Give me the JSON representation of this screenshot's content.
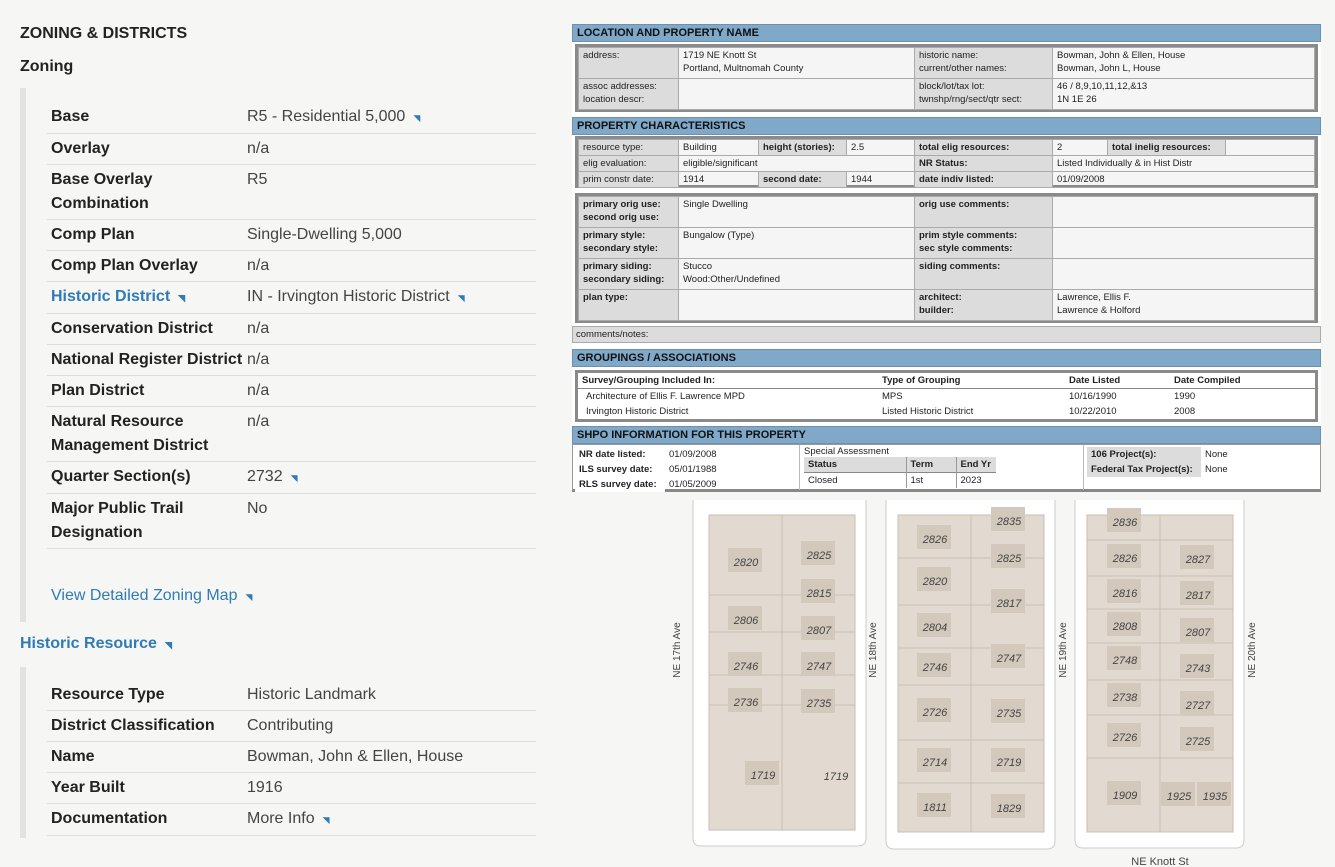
{
  "left": {
    "title": "ZONING & DISTRICTS",
    "subtitle": "Zoning",
    "zoning": [
      {
        "label": "Base",
        "value": "R5 - Residential 5,000",
        "link": true
      },
      {
        "label": "Overlay",
        "value": "n/a"
      },
      {
        "label": "Base Overlay Combination",
        "value": "R5"
      },
      {
        "label": "Comp Plan",
        "value": "Single-Dwelling 5,000"
      },
      {
        "label": "Comp Plan Overlay",
        "value": "n/a"
      },
      {
        "label": "Historic District",
        "value": "IN - Irvington Historic District",
        "link": true
      },
      {
        "label": "Conservation District",
        "value": "n/a"
      },
      {
        "label": "National Register District",
        "value": "n/a"
      },
      {
        "label": "Plan District",
        "value": "n/a"
      },
      {
        "label": "Natural Resource Management District",
        "value": "n/a"
      },
      {
        "label": "Quarter Section(s)",
        "value": "2732",
        "link": true
      },
      {
        "label": "Major Public Trail Designation",
        "value": "No"
      }
    ],
    "view_map_link": "View Detailed Zoning Map",
    "historic_title": "Historic Resource",
    "historic": [
      {
        "label": "Resource Type",
        "value": "Historic Landmark"
      },
      {
        "label": "District Classification",
        "value": "Contributing"
      },
      {
        "label": "Name",
        "value": "Bowman, John & Ellen, House"
      },
      {
        "label": "Year Built",
        "value": "1916"
      },
      {
        "label": "Documentation",
        "value": "More Info",
        "link": true
      }
    ]
  },
  "record": {
    "s1": "LOCATION AND PROPERTY NAME",
    "address_l": "address:",
    "address1": "1719 NE Knott St",
    "address2": "Portland, Multnomah County",
    "assoc_l": "assoc addresses:",
    "locdesc_l": "location descr:",
    "hist_name_l": "historic name:",
    "hist_name": "Bowman, John & Ellen, House",
    "other_l": "current/other names:",
    "other": "Bowman, John L, House",
    "block_l": "block/lot/tax lot:",
    "block": "46 / 8,9,10,11,12,&13",
    "twn_l": "twnshp/rng/sect/qtr sect:",
    "twn": "1N 1E 26",
    "s2": "PROPERTY CHARACTERISTICS",
    "rtype_l": "resource type:",
    "rtype": "Building",
    "height_l": "height (stories):",
    "height": "2.5",
    "telig_l": "total elig resources:",
    "telig": "2",
    "tinelig_l": "total inelig resources:",
    "elig_l": "elig evaluation:",
    "elig": "eligible/significant",
    "nr_l": "NR Status:",
    "nr": "Listed Individually & in Hist Distr",
    "pcd_l": "prim constr date:",
    "pcd": "1914",
    "sd_l": "second date:",
    "sd": "1944",
    "dil_l": "date indiv listed:",
    "dil": "01/09/2008",
    "pou_l": "primary orig use:",
    "pou": "Single Dwelling",
    "sou_l": "second orig use:",
    "ouc_l": "orig use comments:",
    "ps_l": "primary style:",
    "ps": "Bungalow (Type)",
    "ss_l": "secondary style:",
    "psc_l": "prim style comments:",
    "ssc_l": "sec style comments:",
    "psid_l": "primary siding:",
    "psid": "Stucco",
    "ssid_l": "secondary siding:",
    "ssid": "Wood:Other/Undefined",
    "sidc_l": "siding comments:",
    "plan_l": "plan type:",
    "arch_l": "architect:",
    "arch": "Lawrence, Ellis F.",
    "builder_l": "builder:",
    "builder": "Lawrence & Holford",
    "comments_l": "comments/notes:",
    "s3": "GROUPINGS / ASSOCIATIONS",
    "g_headers": [
      "Survey/Grouping Included In:",
      "Type of Grouping",
      "Date Listed",
      "Date Compiled"
    ],
    "groupings": [
      [
        "Architecture of Ellis F. Lawrence MPD",
        "MPS",
        "10/16/1990",
        "1990"
      ],
      [
        "Irvington Historic District",
        "Listed Historic District",
        "10/22/2010",
        "2008"
      ]
    ],
    "s4": "SHPO INFORMATION FOR THIS PROPERTY",
    "nrd_l": "NR date listed:",
    "nrd": "01/09/2008",
    "ils_l": "ILS survey date:",
    "ils": "05/01/1988",
    "rls_l": "RLS survey date:",
    "rls": "01/05/2009",
    "sa_title": "Special Assessment",
    "sa_h": [
      "Status",
      "Term",
      "End Yr"
    ],
    "sa": [
      "Closed",
      "1st",
      "2023"
    ],
    "p106_l": "106 Project(s):",
    "p106": "None",
    "ftp_l": "Federal Tax Project(s):",
    "ftp": "None"
  },
  "map": {
    "streets": [
      "NE 17th Ave",
      "NE 18th Ave",
      "NE 19th Ave",
      "NE 20th Ave",
      "NE Knott St"
    ],
    "parcels": [
      "2820",
      "2825",
      "2815",
      "2806",
      "2807",
      "2746",
      "2747",
      "2736",
      "2735",
      "1719",
      "1719",
      "2835",
      "2826",
      "2825",
      "2820",
      "2817",
      "2804",
      "2747",
      "2746",
      "2726",
      "2735",
      "2714",
      "2719",
      "1811",
      "1829",
      "2836",
      "2826",
      "2827",
      "2816",
      "2817",
      "2808",
      "2807",
      "2748",
      "2743",
      "2738",
      "2727",
      "2726",
      "2725",
      "1909",
      "1925",
      "1935"
    ]
  }
}
